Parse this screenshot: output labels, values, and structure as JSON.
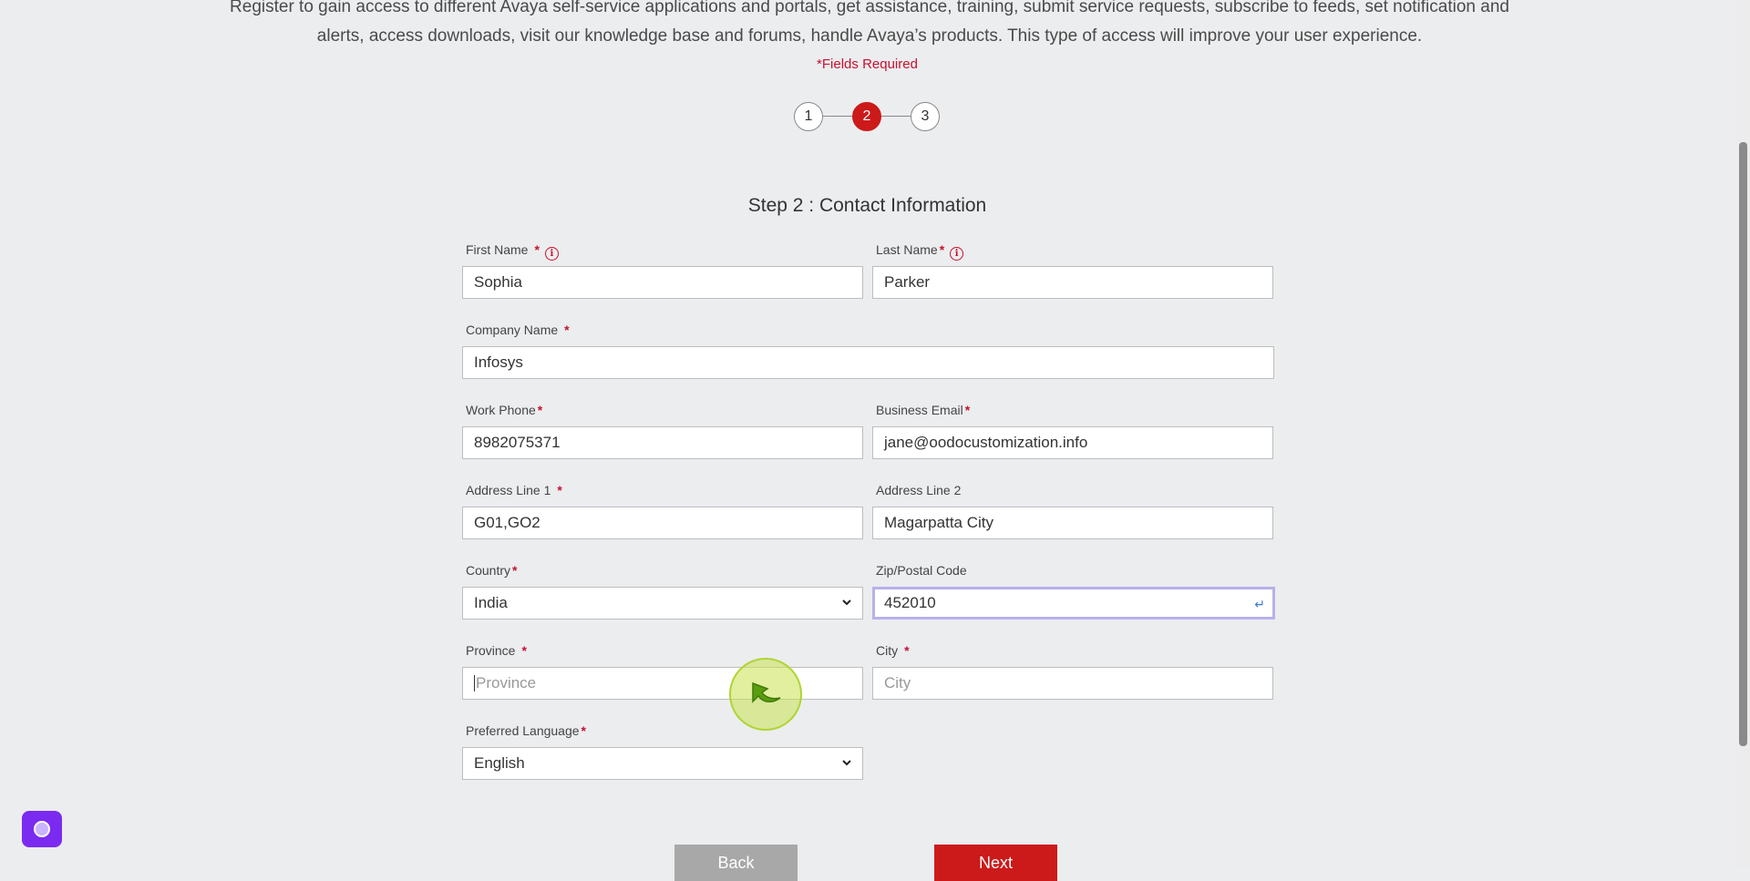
{
  "intro": {
    "line1": "Register to gain access to different Avaya self-service applications and portals, get assistance, training, submit service requests, subscribe to feeds, set notification and",
    "line2": "alerts, access downloads, visit our knowledge base and forums, handle Avaya’s products. This type of access will improve your user experience."
  },
  "fields_required": "*Fields Required",
  "stepper": {
    "steps": [
      "1",
      "2",
      "3"
    ],
    "active_step": 2
  },
  "step_title": "Step 2 : Contact Information",
  "form": {
    "first_name": {
      "label": "First Name",
      "value": "Sophia"
    },
    "last_name": {
      "label": "Last Name",
      "value": "Parker"
    },
    "company_name": {
      "label": "Company Name",
      "value": "Infosys"
    },
    "work_phone": {
      "label": "Work Phone",
      "value": "8982075371"
    },
    "business_email": {
      "label": "Business Email",
      "value": "jane@oodocustomization.info"
    },
    "address_line1": {
      "label": "Address Line 1",
      "value": "G01,GO2"
    },
    "address_line2": {
      "label": "Address Line 2",
      "value": "Magarpatta City"
    },
    "country": {
      "label": "Country",
      "value": "India"
    },
    "zip": {
      "label": "Zip/Postal Code",
      "value": "452010"
    },
    "province": {
      "label": "Province",
      "placeholder": "Province"
    },
    "city": {
      "label": "City",
      "placeholder": "City"
    },
    "preferred_language": {
      "label": "Preferred Language",
      "value": "English"
    }
  },
  "required_marker": "*",
  "info_icon_glyph": "i",
  "enter_hint_glyph": "↵",
  "buttons": {
    "back": "Back",
    "next": "Next"
  },
  "colors": {
    "accent_red": "#cc1a1a",
    "focus_border": "#b8b0ec",
    "chat_widget": "#7b2bf0"
  }
}
